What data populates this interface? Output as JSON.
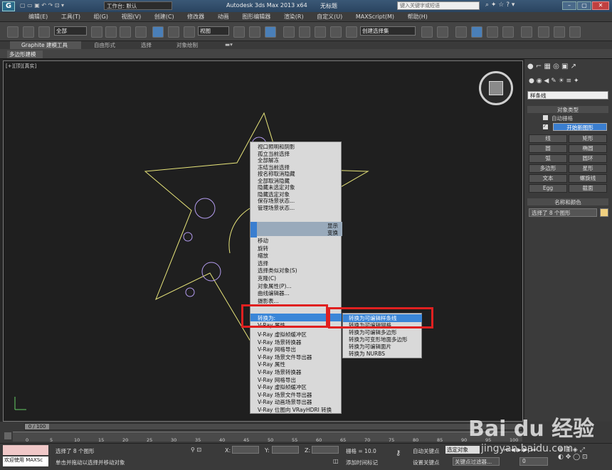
{
  "title_bar": {
    "workspace_label": "工作台: 默认",
    "app_title": "Autodesk 3ds Max  2013 x64",
    "file_title": "无标题",
    "search_placeholder": "键入关键字或短语"
  },
  "menu": [
    "编辑(E)",
    "工具(T)",
    "组(G)",
    "视图(V)",
    "创建(C)",
    "修改器",
    "动画",
    "图形编辑器",
    "渲染(R)",
    "自定义(U)",
    "MAXScript(M)",
    "帮助(H)"
  ],
  "toolbar": {
    "selection_filter": "全部",
    "coord_system": "视图",
    "named_selection": "创建选择集"
  },
  "ribbon": {
    "tabs": [
      "Graphite 建模工具",
      "自由形式",
      "选择",
      "对象绘制"
    ],
    "sub_label": "多边形建模"
  },
  "viewport": {
    "label": "[+][顶][真实]"
  },
  "context_menu": {
    "group1": [
      "视口照明和阴影",
      "孤立当前选择",
      "全部解冻",
      "冻结当前选择",
      "按名称取消隐藏",
      "全部取消隐藏",
      "隐藏未选定对象",
      "隐藏选定对象",
      "保存场景状态...",
      "管理场景状态..."
    ],
    "quad_display": "显示",
    "quad_transform": "变换",
    "group2": [
      "移动",
      "旋转",
      "缩放",
      "选择",
      "选择类似对象(S)",
      "克隆(C)",
      "对象属性(P)...",
      "曲线编辑器...",
      "摄影表..."
    ],
    "convert_to": "转换为:",
    "vray_props": "V-Ray 属性",
    "vray_items": [
      "V-Ray 虚拟帧缓冲区",
      "V-Ray 场景转换器",
      "V-Ray 网格导出",
      "V-Ray 场景文件导出器",
      "V-Ray 属性",
      "V-Ray 场景转换器",
      "V-Ray 网格导出",
      "V-Ray 虚拟帧缓冲区",
      "V-Ray 场景文件导出器",
      "V-Ray 动画场景导出器",
      "V-Ray 位图向 VRayHDRI 转换"
    ]
  },
  "submenu": [
    "转换为可编辑样条线",
    "转换为可编辑网格",
    "转换为可编辑多边形",
    "转换为可变形地面多边形",
    "转换为可编辑面片",
    "转换为 NURBS"
  ],
  "command_panel": {
    "dropdown": "样条线",
    "rollout_type": "对象类型",
    "auto_grid": "自动栅格",
    "start_new_shape": "开始新图形",
    "buttons": [
      "线",
      "矩形",
      "圆",
      "椭圆",
      "弧",
      "圆环",
      "多边形",
      "星形",
      "文本",
      "螺旋线",
      "Egg",
      "截面"
    ],
    "rollout_name": "名称和颜色",
    "name_value": "选择了 8 个图形",
    "name_color": "#f0d080"
  },
  "timeline": {
    "frame": "0 / 100",
    "ticks": [
      "0",
      "5",
      "10",
      "15",
      "20",
      "25",
      "30",
      "35",
      "40",
      "45",
      "50",
      "55",
      "60",
      "65",
      "70",
      "75",
      "80",
      "85",
      "90",
      "95",
      "100"
    ]
  },
  "status": {
    "welcome": "欢迎使用 MAXSc",
    "selected": "选择了 8 个图形",
    "hint": "单击并拖动以选择并移动对象",
    "x_label": "X:",
    "y_label": "Y:",
    "z_label": "Z:",
    "grid": "栅格 = 10.0",
    "add_time_tag": "添加时间标记",
    "auto_key": "自动关键点",
    "set_key": "设置关键点",
    "selected_obj": "选定对象",
    "key_filter": "关键点过滤器...",
    "frame_value": "0"
  },
  "watermark": "Bai du 经验",
  "watermark_url": "jingyan.baidu.com"
}
